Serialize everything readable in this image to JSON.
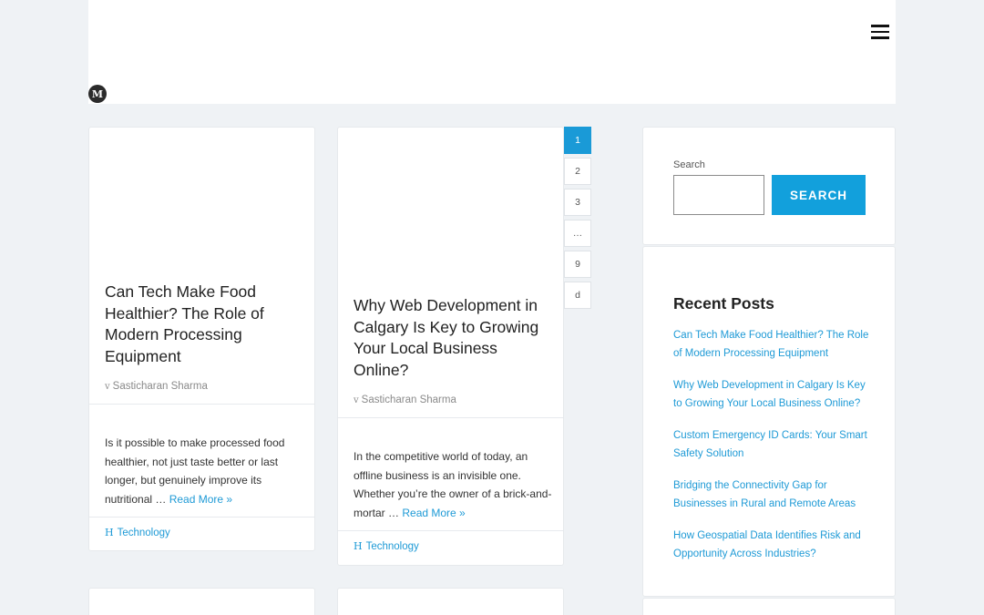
{
  "header": {
    "logo_letter": "M"
  },
  "posts": [
    {
      "title": "Can Tech Make Food Healthier? The Role of Modern Processing Equipment",
      "author_icon": "v",
      "author": "Sasticharan Sharma",
      "excerpt": "Is it possible to make processed food healthier, not just taste better or last longer, but genuinely improve its nutritional …",
      "read_more": "Read More »",
      "category_icon": "H",
      "category": "Technology"
    },
    {
      "title": "Why Web Development in Calgary Is Key to Growing Your Local Business Online?",
      "author_icon": "v",
      "author": "Sasticharan Sharma",
      "excerpt": "In the competitive world of today, an offline business is an invisible one. Whether you’re the owner of a brick-and-mortar …",
      "read_more": "Read More »",
      "category_icon": "H",
      "category": "Technology"
    }
  ],
  "pagination": [
    "1",
    "2",
    "3",
    "…",
    "9",
    "d"
  ],
  "search": {
    "label": "Search",
    "placeholder": "",
    "button_label": "SEARCH"
  },
  "recent_posts": {
    "title": "Recent Posts",
    "items": [
      "Can Tech Make Food Healthier? The Role of Modern Processing Equipment",
      "Why Web Development in Calgary Is Key to Growing Your Local Business Online?",
      "Custom Emergency ID Cards: Your Smart Safety Solution",
      "Bridging the Connectivity Gap for Businesses in Rural and Remote Areas",
      "How Geospatial Data Identifies Risk and Opportunity Across Industries?"
    ]
  },
  "colors": {
    "accent": "#1e9ad6",
    "background": "#eff2f5"
  }
}
